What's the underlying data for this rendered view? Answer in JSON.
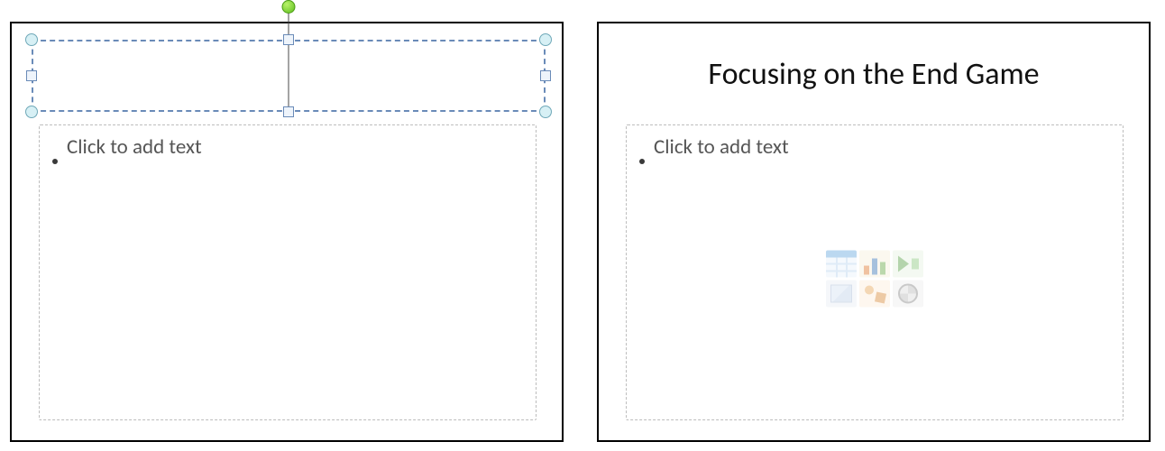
{
  "slides": {
    "left": {
      "title_selected": true,
      "body_placeholder_text": "Click to add text"
    },
    "right": {
      "title": "Focusing on the End Game",
      "body_placeholder_text": "Click to add text"
    }
  },
  "icons": {
    "rotation": "rotation-handle-icon",
    "content_inserts": [
      "insert-table-icon",
      "insert-chart-icon",
      "insert-smartart-icon",
      "insert-picture-icon",
      "insert-clipart-icon",
      "insert-media-icon"
    ]
  },
  "colors": {
    "selection_border": "#6a8bb8",
    "rotation_handle": "#5fbf1f",
    "placeholder_border": "#bdbdbd",
    "placeholder_text": "#555555"
  }
}
